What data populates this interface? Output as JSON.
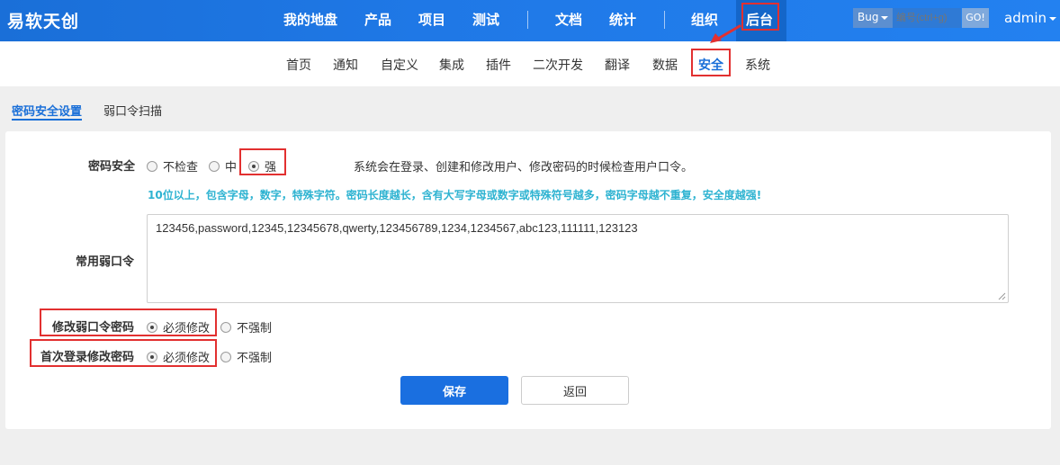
{
  "app": {
    "brand": "易软天创"
  },
  "mainnav": {
    "items": [
      "我的地盘",
      "产品",
      "项目",
      "测试",
      "文档",
      "统计",
      "组织",
      "后台"
    ],
    "active": "后台"
  },
  "search": {
    "type": "Bug",
    "placeholder": "编号(ctrl+g)",
    "go": "GO!"
  },
  "user": {
    "name": "admin"
  },
  "subnav": {
    "items": [
      "首页",
      "通知",
      "自定义",
      "集成",
      "插件",
      "二次开发",
      "翻译",
      "数据",
      "安全",
      "系统"
    ],
    "active": "安全"
  },
  "tabs": [
    "密码安全设置",
    "弱口令扫描"
  ],
  "form": {
    "password_security": {
      "label": "密码安全",
      "options": [
        "不检查",
        "中",
        "强"
      ],
      "selected": "强",
      "hint": "系统会在登录、创建和修改用户、修改密码的时候检查用户口令。",
      "tip": "10位以上，包含字母，数字，特殊字符。密码长度越长，含有大写字母或数字或特殊符号越多，密码字母越不重复，安全度越强!"
    },
    "weak_passwords": {
      "label": "常用弱口令",
      "value": "123456,password,12345,12345678,qwerty,123456789,1234,1234567,abc123,111111,123123"
    },
    "change_weak": {
      "label": "修改弱口令密码",
      "options": [
        "必须修改",
        "不强制"
      ],
      "selected": "必须修改"
    },
    "first_login": {
      "label": "首次登录修改密码",
      "options": [
        "必须修改",
        "不强制"
      ],
      "selected": "必须修改"
    },
    "save_label": "保存",
    "back_label": "返回"
  },
  "colors": {
    "accent": "#1a6fd8",
    "highlight": "#e23030",
    "tip": "#2eb3d1"
  }
}
